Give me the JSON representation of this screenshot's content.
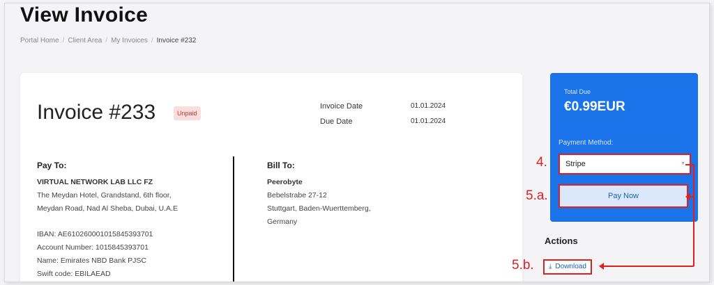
{
  "page": {
    "title": "View Invoice"
  },
  "breadcrumb": [
    "Portal Home",
    "Client Area",
    "My Invoices",
    "Invoice #232"
  ],
  "invoice": {
    "title": "Invoice #233",
    "status": "Unpaid",
    "invoice_date_label": "Invoice Date",
    "invoice_date": "01.01.2024",
    "due_date_label": "Due Date",
    "due_date": "01.01.2024"
  },
  "pay_to": {
    "heading": "Pay To:",
    "company": "VIRTUAL NETWORK LAB LLC FZ",
    "address_lines": [
      "The Meydan Hotel, Grandstand, 6th floor,",
      "Meydan Road, Nad Al Sheba, Dubai, U.A.E"
    ],
    "bank_lines": [
      "IBAN: AE610260001015845393701",
      "Account Number: 1015845393701",
      "Name: Emirates NBD Bank PJSC",
      "Swift code: EBILAEAD"
    ]
  },
  "bill_to": {
    "heading": "Bill To:",
    "company": "Peerobyte",
    "address_lines": [
      "Bebelstrabe 27-12",
      "Stuttgart, Baden-Wuerttemberg,",
      "Germany"
    ]
  },
  "total": {
    "label": "Total Due",
    "value": "€0.99EUR",
    "payment_method_label": "Payment Method:",
    "payment_method_value": "Stripe",
    "pay_now_label": "Pay Now"
  },
  "actions": {
    "heading": "Actions",
    "download_label": "Download"
  },
  "annotations": {
    "step_4": "4.",
    "step_5a": "5.a.",
    "step_5b": "5.b."
  },
  "colors": {
    "accent": "#1a73e8",
    "annotation": "#e02020",
    "unpaid": "#c0392b"
  },
  "icons": {
    "download": "download-icon",
    "select_arrow": "chevron-down-icon"
  }
}
